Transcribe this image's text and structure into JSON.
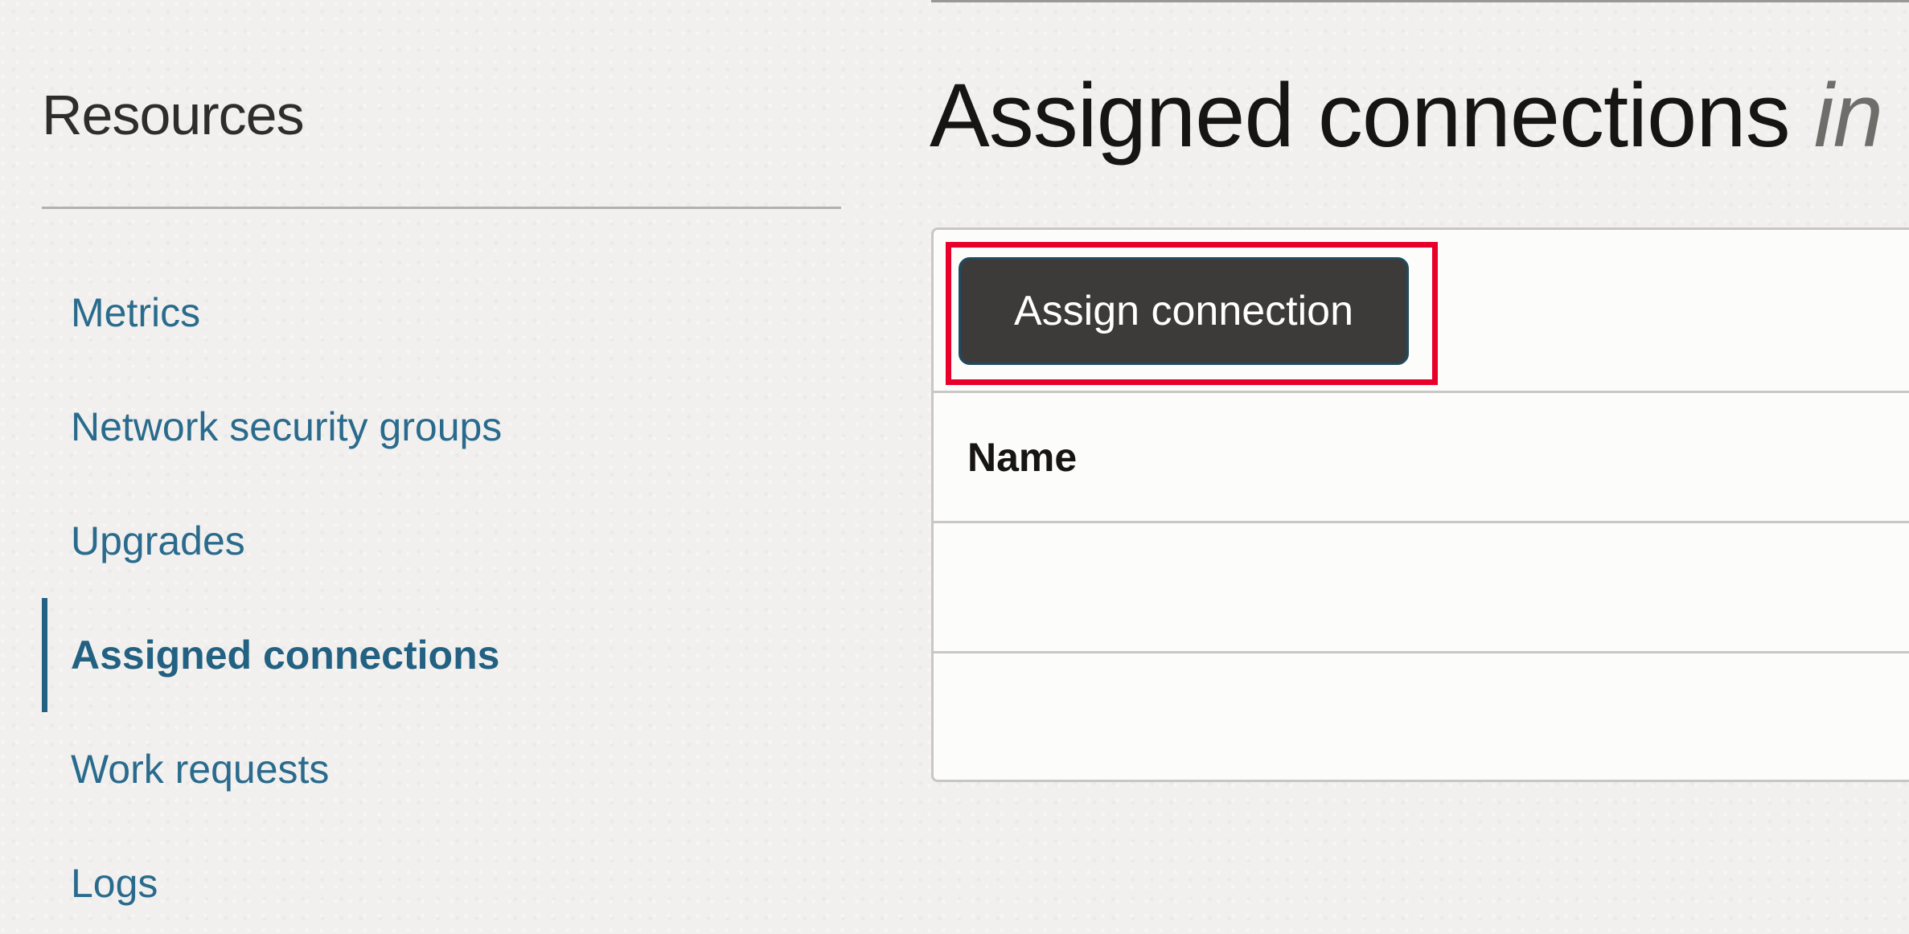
{
  "sidebar": {
    "title": "Resources",
    "items": [
      {
        "label": "Metrics"
      },
      {
        "label": "Network security groups"
      },
      {
        "label": "Upgrades"
      },
      {
        "label": "Assigned connections"
      },
      {
        "label": "Work requests"
      },
      {
        "label": "Logs"
      }
    ],
    "active_index": 3
  },
  "main": {
    "title": "Assigned connections",
    "title_suffix": "in",
    "toolbar": {
      "assign_label": "Assign connection"
    },
    "table": {
      "columns": [
        "Name"
      ],
      "rows": [
        [
          ""
        ],
        [
          ""
        ]
      ]
    }
  },
  "colors": {
    "link": "#2a6b8d",
    "active_link": "#226182",
    "button_bg": "#3c3b39",
    "highlight": "#e8002b"
  }
}
